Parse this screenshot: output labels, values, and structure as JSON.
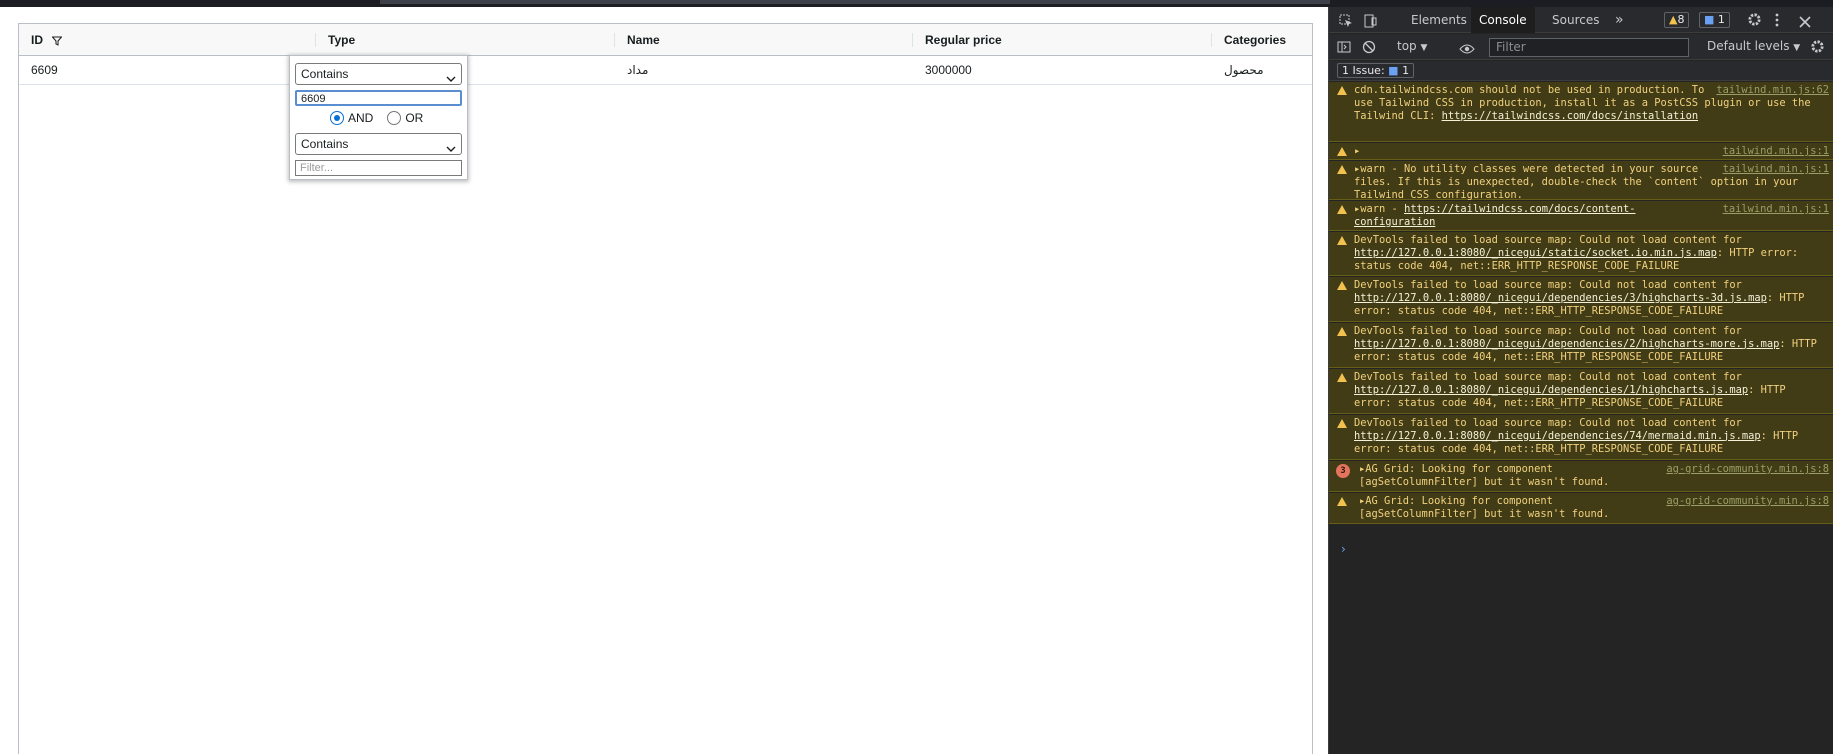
{
  "grid": {
    "columns": [
      {
        "label": "ID",
        "filtered": true
      },
      {
        "label": "Type"
      },
      {
        "label": "Name"
      },
      {
        "label": "Regular price"
      },
      {
        "label": "Categories"
      }
    ],
    "rows": [
      {
        "id": "6609",
        "type": "",
        "name": "مداد",
        "price": "3000000",
        "categories": "محصول"
      }
    ]
  },
  "filter_popup": {
    "condition1": "Contains",
    "value1": "6609",
    "and_label": "AND",
    "or_label": "OR",
    "selected_join": "AND",
    "condition2": "Contains",
    "value2_placeholder": "Filter..."
  },
  "devtools": {
    "tabs": [
      "Elements",
      "Console",
      "Sources"
    ],
    "active_tab": "Console",
    "warn_count": "8",
    "info_count": "1",
    "context": "top",
    "filter_placeholder": "Filter",
    "levels": "Default levels",
    "issues": "1 Issue:",
    "issues_count": "1",
    "messages": [
      {
        "text": "cdn.tailwindcss.com should not be used in production. To use Tailwind CSS in production, install it as a PostCSS plugin or use the Tailwind CLI:",
        "link": "https://tailwindcss.com/docs/installation",
        "tail": "",
        "source": "tailwind.min.js:62",
        "expand": false
      },
      {
        "text": "",
        "link": "",
        "tail": "",
        "source": "tailwind.min.js:1",
        "expand": true
      },
      {
        "text": "warn - No utility classes were detected in your source files. If this is unexpected, double-check the `content` option in your Tailwind CSS configuration.",
        "link": "",
        "tail": "",
        "source": "tailwind.min.js:1",
        "expand": true
      },
      {
        "text": "warn -",
        "link": "https://tailwindcss.com/docs/content-configuration",
        "tail": "",
        "source": "tailwind.min.js:1",
        "expand": true
      },
      {
        "text": "DevTools failed to load source map: Could not load content for",
        "link": "http://127.0.0.1:8080/_nicegui/static/socket.io.min.js.map",
        "tail": ": HTTP error: status code 404, net::ERR_HTTP_RESPONSE_CODE_FAILURE",
        "source": "",
        "expand": false
      },
      {
        "text": "DevTools failed to load source map: Could not load content for",
        "link": "http://127.0.0.1:8080/_nicegui/dependencies/3/highcharts-3d.js.map",
        "tail": ": HTTP error: status code 404, net::ERR_HTTP_RESPONSE_CODE_FAILURE",
        "source": "",
        "expand": false
      },
      {
        "text": "DevTools failed to load source map: Could not load content for",
        "link": "http://127.0.0.1:8080/_nicegui/dependencies/2/highcharts-more.js.map",
        "tail": ": HTTP error: status code 404, net::ERR_HTTP_RESPONSE_CODE_FAILURE",
        "source": "",
        "expand": false
      },
      {
        "text": "DevTools failed to load source map: Could not load content for",
        "link": "http://127.0.0.1:8080/_nicegui/dependencies/1/highcharts.js.map",
        "tail": ": HTTP error: status code 404, net::ERR_HTTP_RESPONSE_CODE_FAILURE",
        "source": "",
        "expand": false
      },
      {
        "text": "DevTools failed to load source map: Could not load content for",
        "link": "http://127.0.0.1:8080/_nicegui/dependencies/74/mermaid.min.js.map",
        "tail": ": HTTP error: status code 404, net::ERR_HTTP_RESPONSE_CODE_FAILURE",
        "source": "",
        "expand": false
      },
      {
        "text": "AG Grid: Looking for component [agSetColumnFilter] but it wasn't found.",
        "link": "",
        "tail": "",
        "source": "ag-grid-community.min.js:8",
        "expand": true,
        "count": "3"
      },
      {
        "text": "AG Grid: Looking for component [agSetColumnFilter] but it wasn't found.",
        "link": "",
        "tail": "",
        "source": "ag-grid-community.min.js:8",
        "expand": true
      }
    ]
  }
}
